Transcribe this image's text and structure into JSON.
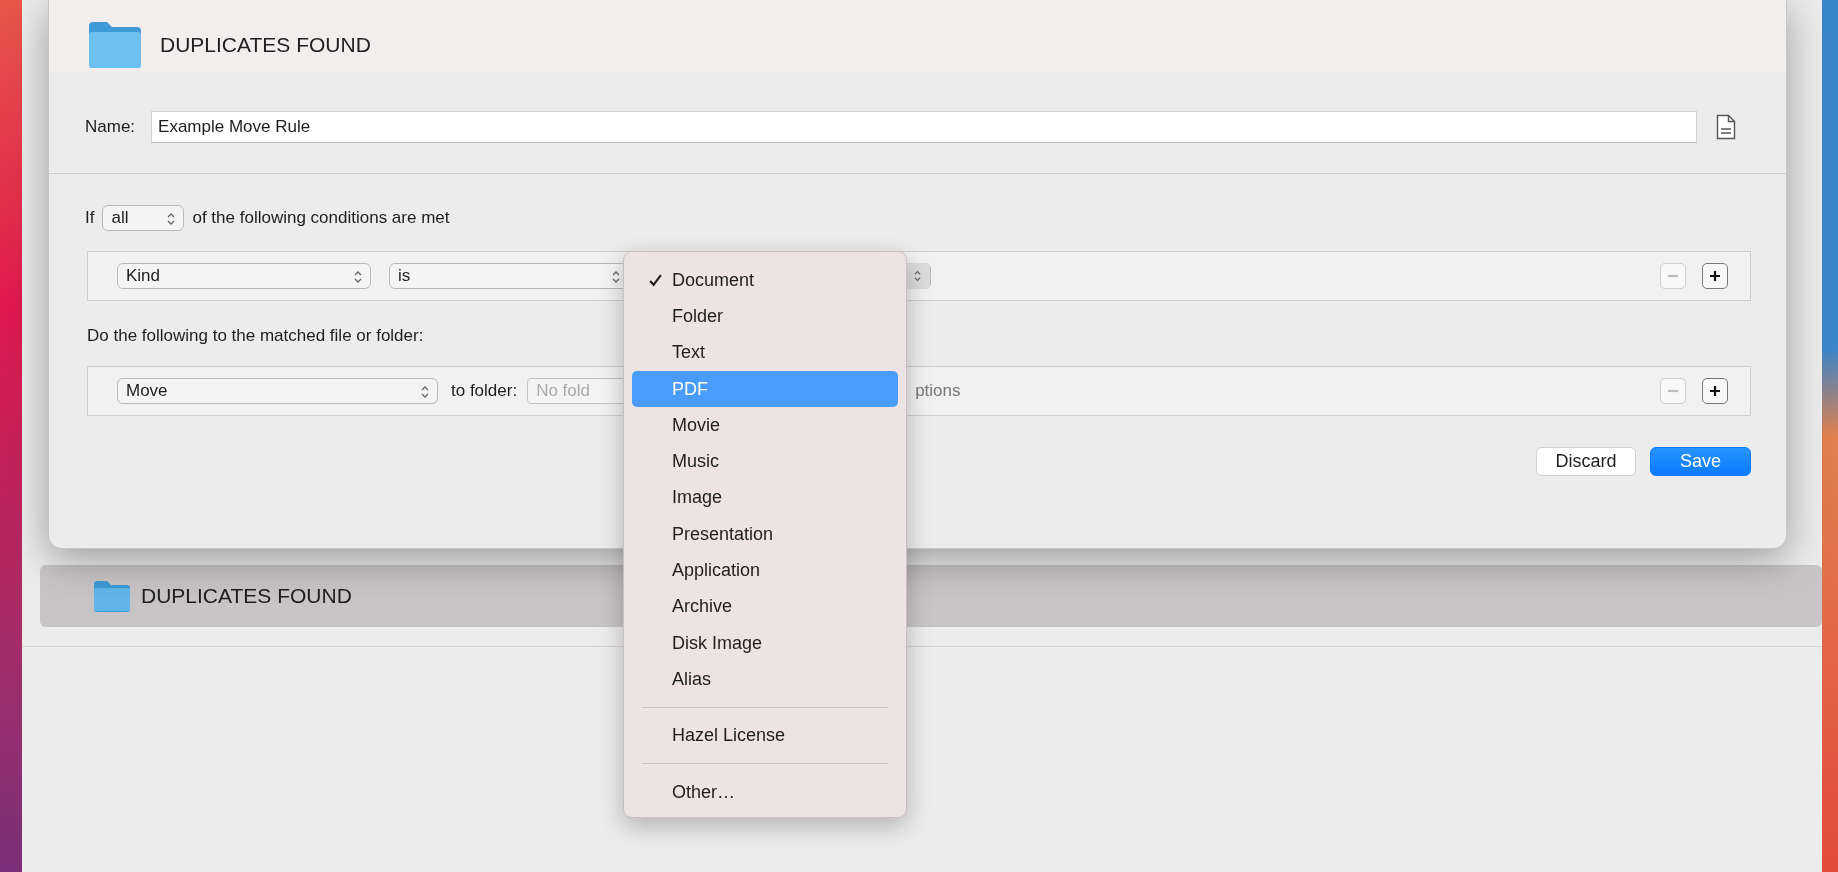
{
  "header": {
    "title": "DUPLICATES FOUND"
  },
  "name": {
    "label": "Name:",
    "value": "Example Move Rule"
  },
  "conditions": {
    "prefix": "If",
    "match": "all",
    "suffix": "of the following conditions are met",
    "rows": [
      {
        "attribute": "Kind",
        "operator": "is",
        "remove_disabled": true
      }
    ]
  },
  "actions": {
    "label": "Do the following to the matched file or folder:",
    "rows": [
      {
        "action": "Move",
        "to_label": "to folder:",
        "folder_placeholder": "No fold",
        "options_text": "ptions",
        "remove_disabled": true
      }
    ]
  },
  "buttons": [
    {
      "label": "Discard",
      "kind": "secondary"
    },
    {
      "label": "Save",
      "kind": "primary"
    }
  ],
  "list": [
    {
      "title": "DUPLICATES FOUND",
      "selected": true
    }
  ],
  "menu": {
    "items": [
      {
        "kind": "item",
        "label": "Document",
        "checked": true,
        "selected": false
      },
      {
        "kind": "item",
        "label": "Folder",
        "checked": false,
        "selected": false
      },
      {
        "kind": "item",
        "label": "Text",
        "checked": false,
        "selected": false
      },
      {
        "kind": "item",
        "label": "PDF",
        "checked": false,
        "selected": true
      },
      {
        "kind": "item",
        "label": "Movie",
        "checked": false,
        "selected": false
      },
      {
        "kind": "item",
        "label": "Music",
        "checked": false,
        "selected": false
      },
      {
        "kind": "item",
        "label": "Image",
        "checked": false,
        "selected": false
      },
      {
        "kind": "item",
        "label": "Presentation",
        "checked": false,
        "selected": false
      },
      {
        "kind": "item",
        "label": "Application",
        "checked": false,
        "selected": false
      },
      {
        "kind": "item",
        "label": "Archive",
        "checked": false,
        "selected": false
      },
      {
        "kind": "item",
        "label": "Disk Image",
        "checked": false,
        "selected": false
      },
      {
        "kind": "item",
        "label": "Alias",
        "checked": false,
        "selected": false
      },
      {
        "kind": "separator"
      },
      {
        "kind": "item",
        "label": "Hazel License",
        "checked": false,
        "selected": false
      },
      {
        "kind": "separator"
      },
      {
        "kind": "item",
        "label": "Other…",
        "checked": false,
        "selected": false
      }
    ]
  }
}
